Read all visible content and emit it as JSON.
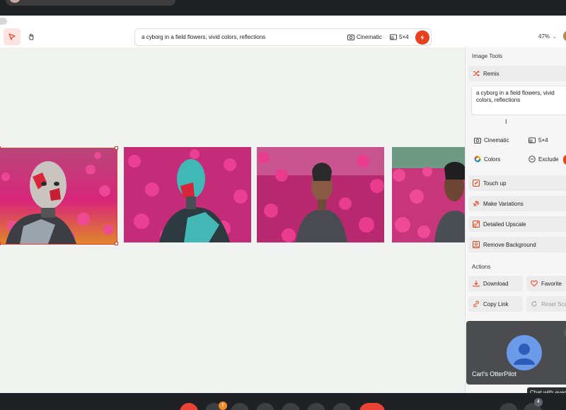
{
  "toolbar": {
    "prompt": "a cyborg in a field flowers, vivid colors, reflections",
    "style_label": "Cinematic",
    "ratio_label": "5×4",
    "zoom": "47%"
  },
  "panel": {
    "image_tools_title": "Image Tools",
    "remix_label": "Remix",
    "remix_prompt": "a cyborg in a field flowers, vivid colors, reflections",
    "style_label": "Cinematic",
    "ratio_label": "5×4",
    "colors_label": "Colors",
    "exclude_label": "Exclude",
    "tools": [
      {
        "label": "Touch up",
        "icon": "pencil-icon"
      },
      {
        "label": "Make Variations",
        "icon": "variations-icon"
      },
      {
        "label": "Detailed Upscale",
        "icon": "upscale-icon"
      },
      {
        "label": "Remove Background",
        "icon": "remove-bg-icon"
      }
    ],
    "actions_title": "Actions",
    "actions": {
      "download": "Download",
      "favorite": "Favorite",
      "copy_link": "Copy Link",
      "reset_scale": "Reset Scale"
    }
  },
  "video": {
    "participant_name": "Carl's OtterPilot",
    "tooltip": "Chat with everyone",
    "people_count": "4"
  },
  "colors": {
    "accent": "#e8411e",
    "selection": "#e53b30",
    "flowers": "#d8257a"
  }
}
